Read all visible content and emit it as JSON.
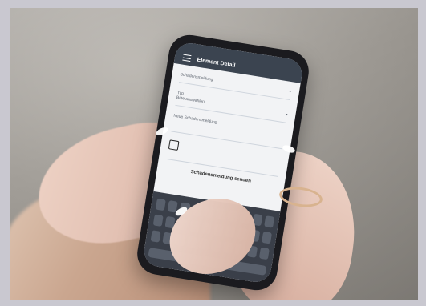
{
  "phone": {
    "status_time": "",
    "header_title": "Element Detail",
    "section_label": "Schadensmeldung",
    "field1_label": "Typ",
    "field1_value": "Bitte auswählen",
    "field2_label": "Neue Schadensmeldung",
    "field2_value": "",
    "action_label": "Schadensmeldung senden"
  },
  "icons": {
    "menu": "hamburger-menu-icon",
    "camera": "camera-icon",
    "chevron": "chevron-down-icon"
  }
}
